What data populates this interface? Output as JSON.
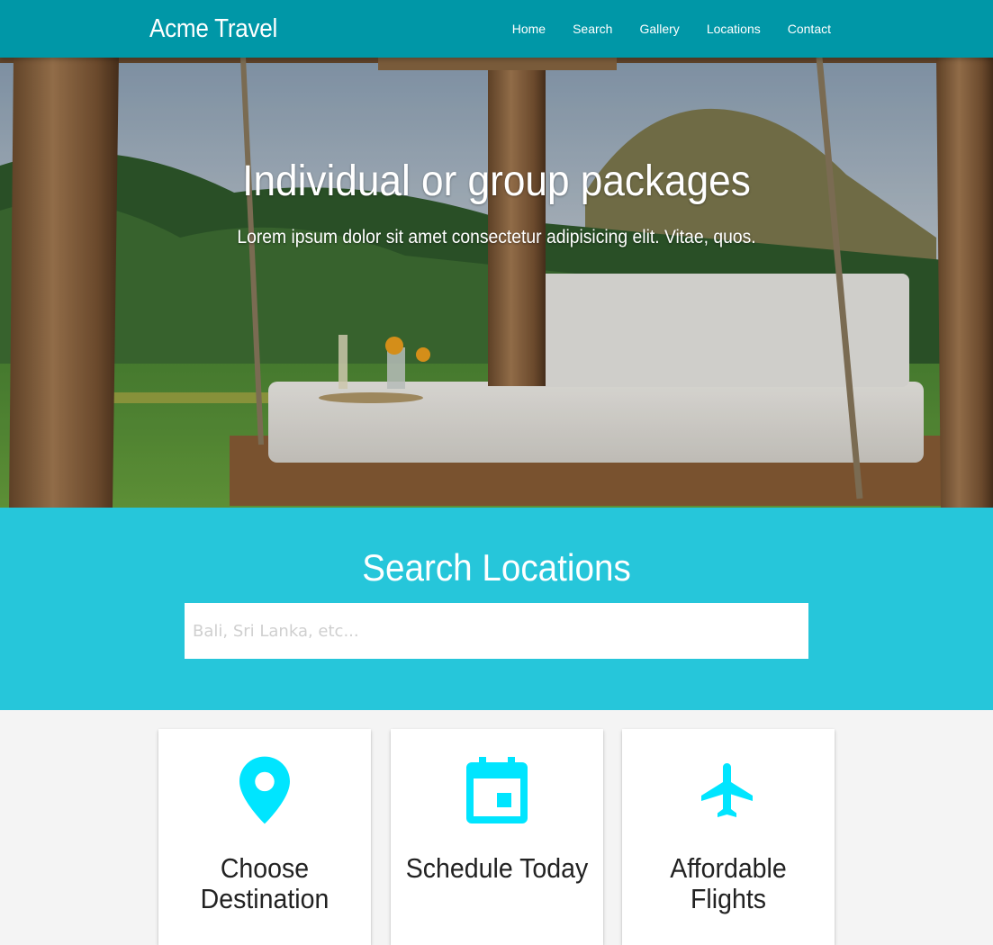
{
  "brand": "Acme Travel",
  "nav": [
    "Home",
    "Search",
    "Gallery",
    "Locations",
    "Contact"
  ],
  "hero": {
    "title": "Individual or group packages",
    "subtitle": "Lorem ipsum dolor sit amet consectetur adipisicing elit. Vitae, quos."
  },
  "search": {
    "title": "Search Locations",
    "placeholder": "Bali, Sri Lanka, etc...",
    "value": ""
  },
  "cards": [
    {
      "icon": "place-icon",
      "title": "Choose Destination"
    },
    {
      "icon": "calendar-icon",
      "title": "Schedule Today"
    },
    {
      "icon": "flight-icon",
      "title": "Affordable Flights"
    }
  ],
  "colors": {
    "navbar": "#0097a7",
    "search_section": "#26c6da",
    "icon_accent": "#00e5ff",
    "page_background": "#f4f4f4"
  }
}
